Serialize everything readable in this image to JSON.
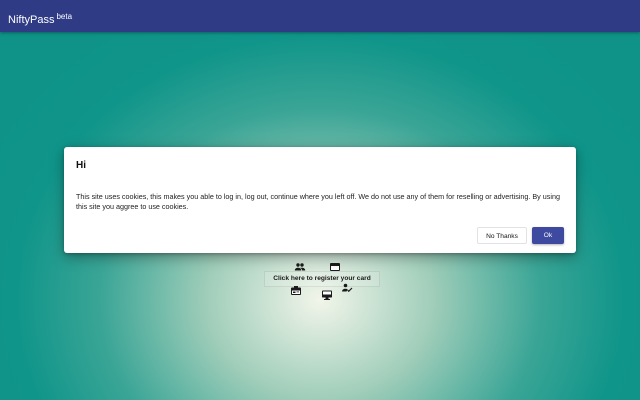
{
  "appbar": {
    "brand": "NiftyPass",
    "badge": "beta",
    "color": "#2f3b85"
  },
  "widget": {
    "register_label": "Click here to register your card",
    "icons": [
      "people-icon",
      "credit-card-icon",
      "id-card-icon",
      "desktop-icon",
      "signature-icon"
    ]
  },
  "dialog": {
    "title": "Hi",
    "message": "This site uses cookies, this makes you able to log in, log out, continue where you left off. We do not use any of them for reselling or advertising. By using this site you aggree to use cookies.",
    "no_thanks_label": "No Thanks",
    "ok_label": "Ok",
    "ok_color": "#3d4aa0"
  }
}
